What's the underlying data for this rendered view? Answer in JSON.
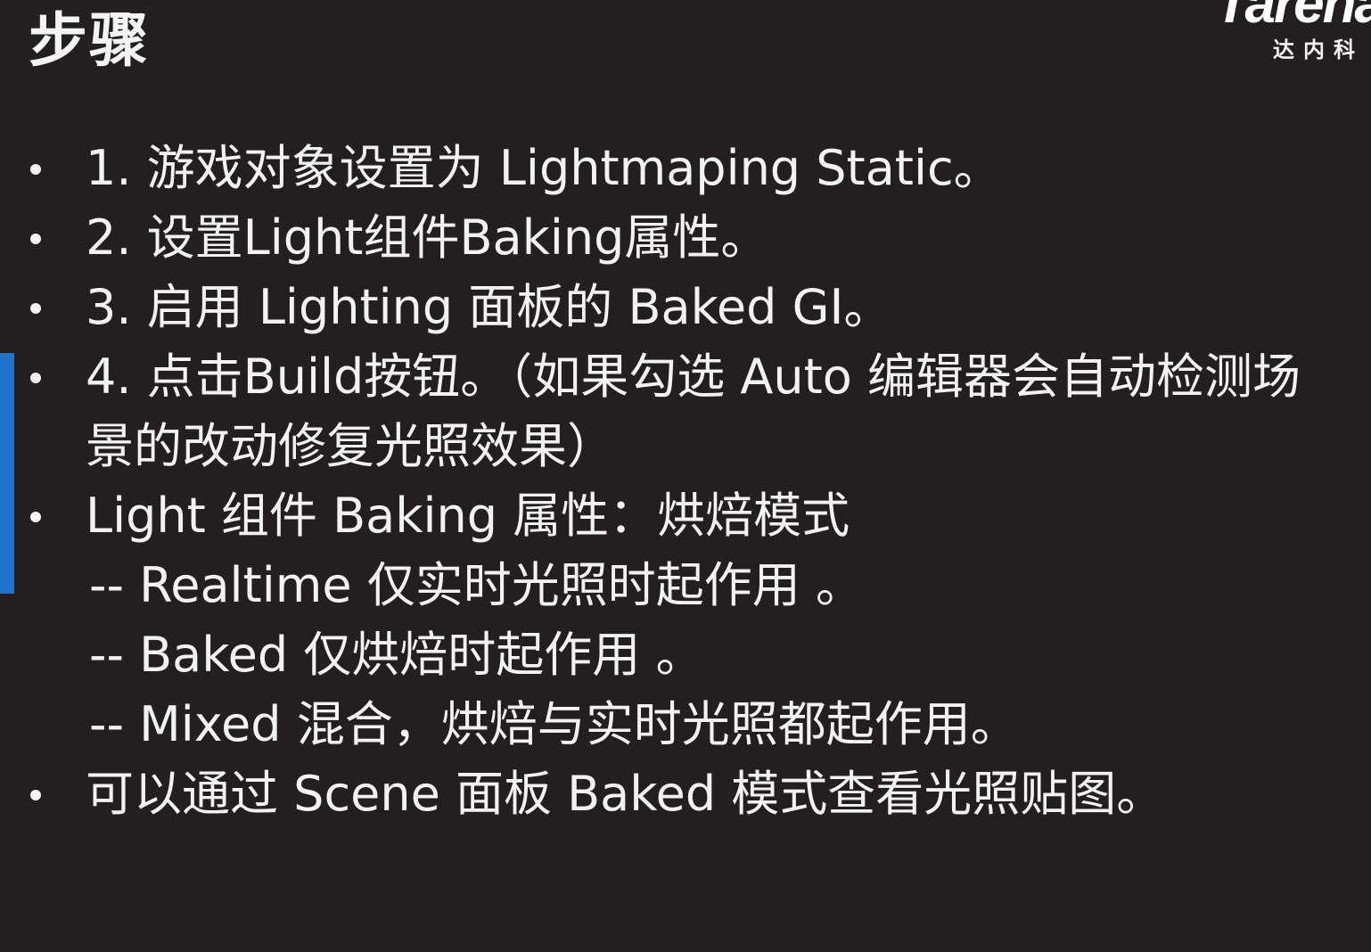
{
  "slide": {
    "title": "步骤",
    "logo": {
      "word": "Tarena",
      "subtitle": "达内科"
    },
    "items": [
      {
        "type": "bullet",
        "text": "1. 游戏对象设置为 Lightmaping Static。"
      },
      {
        "type": "bullet",
        "text": "2. 设置Light组件Baking属性。"
      },
      {
        "type": "bullet",
        "text": "3. 启用 Lighting 面板的 Baked GI。"
      },
      {
        "type": "bullet",
        "text": "4. 点击Build按钮。（如果勾选 Auto 编辑器会自动检测场",
        "continuation": "景的改动修复光照效果）"
      },
      {
        "type": "bullet",
        "text": "Light 组件 Baking 属性：烘焙模式"
      },
      {
        "type": "sub",
        "text": "-- Realtime 仅实时光照时起作用 。"
      },
      {
        "type": "sub",
        "text": "-- Baked 仅烘焙时起作用 。"
      },
      {
        "type": "sub",
        "text": "-- Mixed 混合，烘焙与实时光照都起作用。"
      },
      {
        "type": "bullet",
        "text": "可以通过 Scene 面板 Baked 模式查看光照贴图。"
      }
    ]
  },
  "colors": {
    "background": "#231f20",
    "text": "#f2f2f2",
    "accent": "#1f73c9"
  }
}
